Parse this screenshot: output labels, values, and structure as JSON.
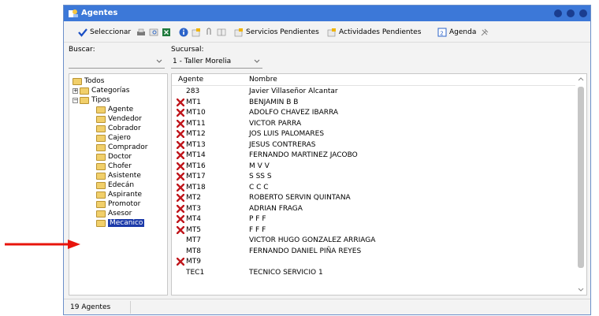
{
  "window": {
    "title": "Agentes"
  },
  "toolbar": {
    "seleccionar_label": "Seleccionar",
    "servicios_label": "Servicios Pendientes",
    "actividades_label": "Actividades Pendientes",
    "agenda_label": "Agenda"
  },
  "filters": {
    "buscar_label": "Buscar:",
    "buscar_value": "",
    "sucursal_label": "Sucursal:",
    "sucursal_value": "1 - Taller Morelia"
  },
  "tree": {
    "root": "Todos",
    "categorias": "Categorías",
    "tipos": "Tipos",
    "tipos_children": [
      "Agente",
      "Vendedor",
      "Cobrador",
      "Cajero",
      "Comprador",
      "Doctor",
      "Chofer",
      "Asistente",
      "Edecán",
      "Aspirante",
      "Promotor",
      "Asesor",
      "Mecanico"
    ]
  },
  "list": {
    "col_agente": "Agente",
    "col_nombre": "Nombre",
    "rows": [
      {
        "agente": "283",
        "nombre": "Javier Villaseñor Alcantar",
        "x": false
      },
      {
        "agente": "MT1",
        "nombre": "BENJAMIN B B",
        "x": true
      },
      {
        "agente": "MT10",
        "nombre": "ADOLFO CHAVEZ IBARRA",
        "x": true
      },
      {
        "agente": "MT11",
        "nombre": "VICTOR PARRA",
        "x": true
      },
      {
        "agente": "MT12",
        "nombre": "JOS LUIS PALOMARES",
        "x": true
      },
      {
        "agente": "MT13",
        "nombre": "JESUS CONTRERAS",
        "x": true
      },
      {
        "agente": "MT14",
        "nombre": "FERNANDO MARTINEZ JACOBO",
        "x": true
      },
      {
        "agente": "MT16",
        "nombre": "M V V",
        "x": true
      },
      {
        "agente": "MT17",
        "nombre": "S SS S",
        "x": true
      },
      {
        "agente": "MT18",
        "nombre": "C C C",
        "x": true
      },
      {
        "agente": "MT2",
        "nombre": "ROBERTO SERVIN QUINTANA",
        "x": true
      },
      {
        "agente": "MT3",
        "nombre": "ADRIAN FRAGA",
        "x": true
      },
      {
        "agente": "MT4",
        "nombre": "P F F",
        "x": true
      },
      {
        "agente": "MT5",
        "nombre": "F F F",
        "x": true
      },
      {
        "agente": "MT7",
        "nombre": "VICTOR HUGO GONZALEZ ARRIAGA",
        "x": false
      },
      {
        "agente": "MT8",
        "nombre": "FERNANDO DANIEL PIÑA REYES",
        "x": false
      },
      {
        "agente": "MT9",
        "nombre": "",
        "x": true
      },
      {
        "agente": "TEC1",
        "nombre": "TECNICO SERVICIO 1",
        "x": false
      }
    ]
  },
  "status": {
    "count_text": "19 Agentes"
  },
  "colors": {
    "titlebar": "#3c78d8",
    "selected": "#1c3aa9",
    "x_mark": "#c0161c",
    "arrow": "#e8140c"
  }
}
